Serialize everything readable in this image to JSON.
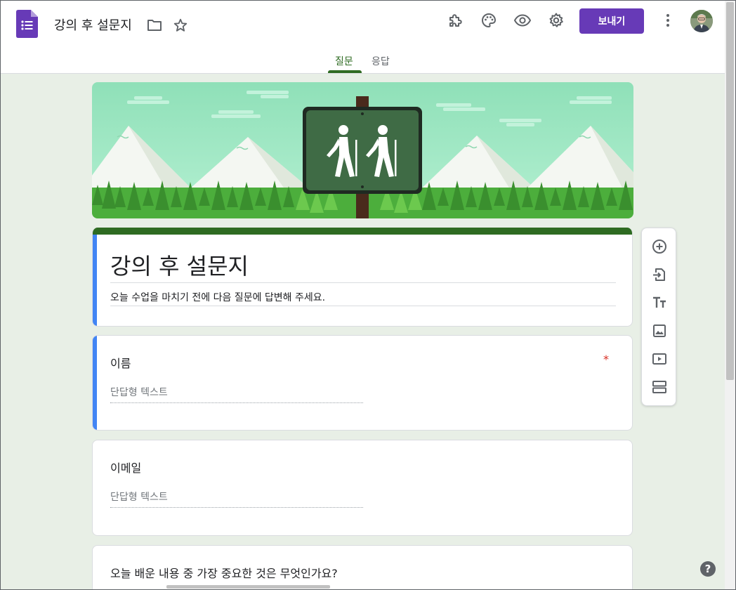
{
  "header": {
    "doc_title": "강의 후 설문지",
    "send_label": "보내기"
  },
  "tabs": [
    {
      "label": "질문",
      "active": true
    },
    {
      "label": "응답",
      "active": false
    }
  ],
  "form": {
    "title": "강의 후 설문지",
    "description": "오늘 수업을 마치기 전에 다음 질문에 답변해 주세요."
  },
  "questions": [
    {
      "title": "이름",
      "required_mark": "*",
      "answer_placeholder": "단답형 텍스트"
    },
    {
      "title": "이메일",
      "answer_placeholder": "단답형 텍스트"
    },
    {
      "title": "오늘 배운 내용 중 가장 중요한 것은 무엇인가요?"
    }
  ],
  "help": {
    "label": "?"
  },
  "colors": {
    "theme": "#2e6b22",
    "accent_purple": "#673ab7",
    "background": "#e8efe6",
    "focus_bar": "#4285f4"
  },
  "icons": [
    "forms-logo-icon",
    "folder-icon",
    "star-icon",
    "addon-puzzle-icon",
    "palette-icon",
    "preview-eye-icon",
    "settings-gear-icon",
    "more-vert-icon",
    "add-question-icon",
    "import-questions-icon",
    "add-title-icon",
    "add-image-icon",
    "add-video-icon",
    "add-section-icon",
    "help-icon"
  ]
}
